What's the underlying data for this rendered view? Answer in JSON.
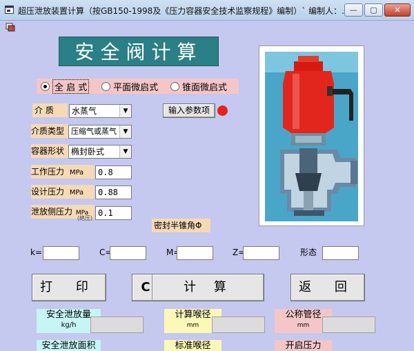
{
  "window": {
    "title": "超压泄放装置计算（按GB150-1998及《压力容器安全技术监察规程》编制）` 编制人：...",
    "min": "—",
    "max": "▢",
    "close": "✕"
  },
  "heading": "安全阀计算",
  "radios": [
    {
      "label": "全 启 式",
      "checked": true
    },
    {
      "label": "平面微启式",
      "checked": false
    },
    {
      "label": "锥面微启式",
      "checked": false
    }
  ],
  "medium": {
    "label": "介  质",
    "value": "水蒸气"
  },
  "medium_type": {
    "label": "介质类型",
    "value": "压缩气或蒸气"
  },
  "vessel_shape": {
    "label": "容器形状",
    "value": "椭封卧式"
  },
  "work_pressure": {
    "label": "工作压力",
    "unit": "MPa",
    "value": "0.8"
  },
  "design_pressure": {
    "label": "设计压力",
    "unit": "MPa",
    "value": "0.88"
  },
  "relief_side_pressure": {
    "label": "泄放侧压力",
    "unit": "MPa",
    "note": "(绝压)",
    "value": "0.1"
  },
  "input_button": "输入参数项",
  "seal_angle": "密封半锥角Φ",
  "params": [
    {
      "label": "k=",
      "value": ""
    },
    {
      "label": "C=",
      "value": ""
    },
    {
      "label": "M=",
      "value": ""
    },
    {
      "label": "Z=",
      "value": ""
    },
    {
      "label": "形态",
      "value": ""
    }
  ],
  "buttons": {
    "print": "打 印",
    "calc_c": "C",
    "calc": "计  算",
    "back": "返 回"
  },
  "results": [
    {
      "label": "安全泄放量",
      "unit": "kg/h"
    },
    {
      "label": "计算喉径",
      "unit": "mm"
    },
    {
      "label": "公称管径",
      "unit": "mm"
    },
    {
      "label": "安全泄放面积",
      "unit": ""
    },
    {
      "label": "标准喉径",
      "unit": ""
    },
    {
      "label": "开启压力",
      "unit": ""
    }
  ],
  "colors": {
    "indicator": "#e8201f",
    "heading_bg": "#2b7f86",
    "form_bg": "#c5c8ef"
  }
}
